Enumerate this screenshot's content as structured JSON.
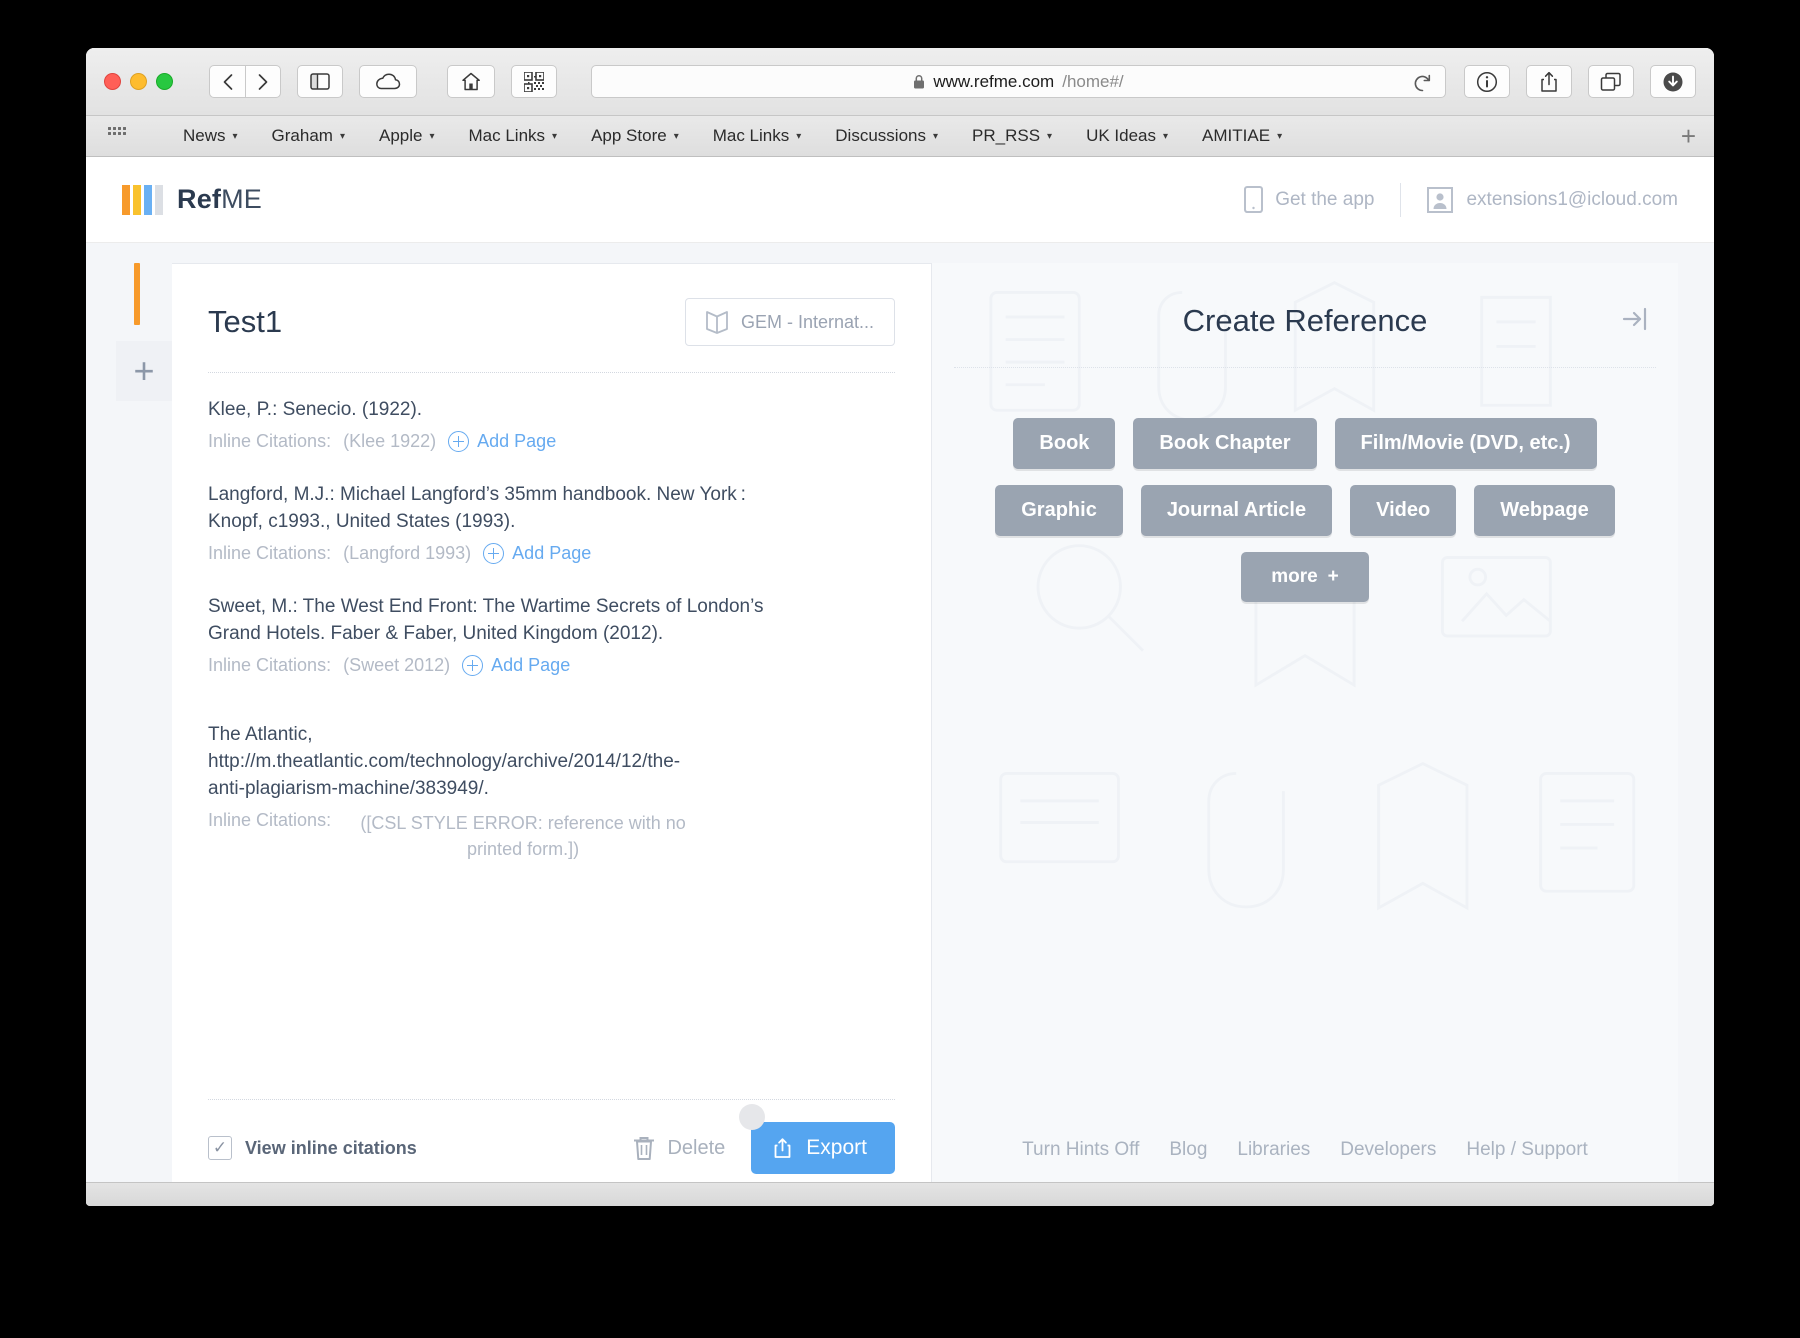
{
  "browser": {
    "url_host": "www.refme.com",
    "url_path": "/home#/",
    "lock_icon": "lock-icon",
    "back_icon": "back-chevron-icon",
    "forward_icon": "forward-chevron-icon",
    "sidebar_icon": "sidebar-toggle-icon",
    "cloud_icon": "icloud-tabs-icon",
    "home_icon": "home-icon",
    "qr_icon": "qr-code-icon",
    "reload_icon": "reload-icon",
    "info_icon": "info-icon",
    "share_icon": "share-icon",
    "tabs_icon": "show-tabs-icon",
    "download_icon": "downloads-icon",
    "bookmarks": [
      {
        "label": "News"
      },
      {
        "label": "Graham"
      },
      {
        "label": "Apple"
      },
      {
        "label": "Mac Links"
      },
      {
        "label": "App Store"
      },
      {
        "label": "Mac Links"
      },
      {
        "label": "Discussions"
      },
      {
        "label": "PR_RSS"
      },
      {
        "label": "UK Ideas"
      },
      {
        "label": "AMITIAE"
      }
    ],
    "new_tab_label": "+"
  },
  "site_header": {
    "logo_ref": "Ref",
    "logo_me": "ME",
    "logo_colors": [
      "#f79a2b",
      "#f9c22e",
      "#6ab0f3",
      "#dcdfe4"
    ],
    "get_app_label": "Get the app",
    "account_email": "extensions1@icloud.com"
  },
  "project": {
    "title": "Test1",
    "style_label": "GEM - Internat...",
    "style_icon": "book-icon",
    "add_project_label": "+",
    "citations": [
      {
        "text": "Klee, P.: Senecio. (1922).",
        "inline_label": "Inline Citations:",
        "inline_value": "(Klee 1922)",
        "add_page_label": "Add Page"
      },
      {
        "text": "Langford, M.J.: Michael Langford’s 35mm handbook. New York : Knopf, c1993., United States (1993).",
        "inline_label": "Inline Citations:",
        "inline_value": "(Langford 1993)",
        "add_page_label": "Add Page"
      },
      {
        "text": "Sweet, M.: The West End Front: The Wartime Secrets of London’s Grand Hotels. Faber & Faber, United Kingdom (2012).",
        "inline_label": "Inline Citations:",
        "inline_value": "(Sweet 2012)",
        "add_page_label": "Add Page"
      },
      {
        "text": "The Atlantic, http://m.theatlantic.com/technology/archive/2014/12/the-anti-plagiarism-machine/383949/.",
        "inline_label": "Inline Citations:",
        "inline_value": "([CSL STYLE ERROR: reference with no printed form.])",
        "add_page_label": ""
      }
    ],
    "view_inline_label": "View inline citations",
    "view_inline_checked": "✓",
    "delete_label": "Delete",
    "export_label": "Export"
  },
  "create_panel": {
    "title": "Create Reference",
    "collapse_icon": "collapse-panel-icon",
    "type_rows": [
      [
        "Book",
        "Book Chapter",
        "Film/Movie (DVD, etc.)"
      ],
      [
        "Graphic",
        "Journal Article",
        "Video",
        "Webpage"
      ]
    ],
    "more_label": "more",
    "more_plus": "+",
    "footer_links": [
      "Turn Hints Off",
      "Blog",
      "Libraries",
      "Developers",
      "Help / Support"
    ]
  },
  "colors": {
    "accent_orange": "#f79a2b",
    "link_blue": "#66aaf0",
    "export_blue": "#55a5f0",
    "button_grey": "#9aa4b1",
    "heading": "#2b3a4f"
  }
}
